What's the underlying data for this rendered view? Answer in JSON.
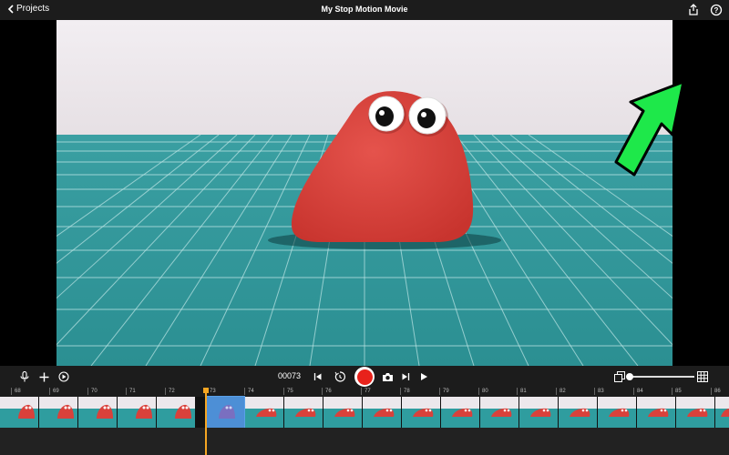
{
  "header": {
    "back_label": "Projects",
    "title": "My Stop Motion Movie",
    "share_icon": "share-icon",
    "help_icon": "help-icon"
  },
  "controls": {
    "frame_counter": "00073",
    "icons": [
      "microphone-icon",
      "plus-icon",
      "playback-speed-icon",
      "skip-to-start-icon",
      "timer-icon",
      "record-icon",
      "camera-icon",
      "step-forward-icon",
      "play-icon",
      "overlay-icon",
      "grid-icon"
    ],
    "record_color": "#e8221b",
    "zoom_level": 0
  },
  "timeline": {
    "frame_numbers": [
      "68",
      "69",
      "70",
      "71",
      "72",
      "73",
      "74",
      "75",
      "76",
      "77",
      "78",
      "79",
      "80",
      "81",
      "82",
      "83",
      "84",
      "85",
      "86"
    ],
    "selected_frame": "73",
    "playhead_color": "#f5a623"
  },
  "colors": {
    "accent": "#1ee84a",
    "clay": "#d9413b",
    "mat": "#2f9d9f"
  }
}
